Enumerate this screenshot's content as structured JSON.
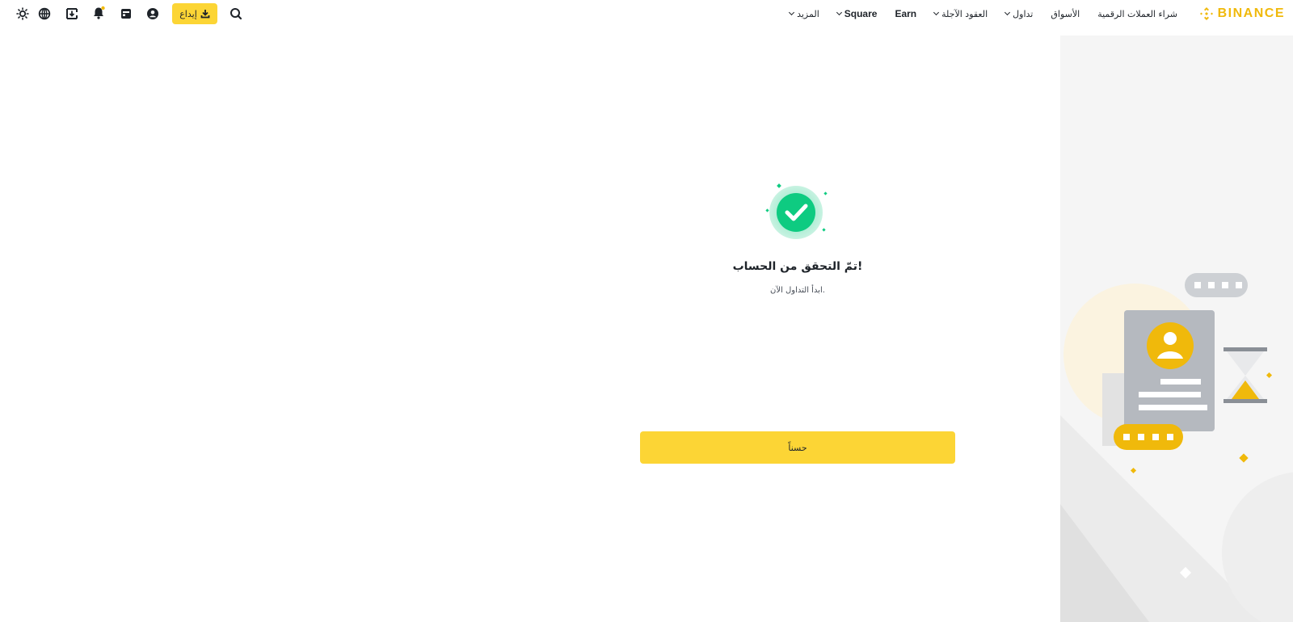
{
  "brand": {
    "name": "BINANCE",
    "color": "#F0B90B"
  },
  "nav": {
    "items": [
      {
        "label": "شراء العملات الرقمية",
        "has_dropdown": false
      },
      {
        "label": "الأسواق",
        "has_dropdown": false
      },
      {
        "label": "تداول",
        "has_dropdown": true
      },
      {
        "label": "العقود الآجلة",
        "has_dropdown": true
      },
      {
        "label": "Earn",
        "has_dropdown": false
      },
      {
        "label": "Square",
        "has_dropdown": true
      },
      {
        "label": "المزيد",
        "has_dropdown": true
      }
    ]
  },
  "toolbar": {
    "deposit_label": "إيداع",
    "icons": [
      "search-icon",
      "user-icon",
      "orders-icon",
      "notification-icon",
      "download-app-icon",
      "language-globe-icon",
      "theme-toggle-icon"
    ]
  },
  "main": {
    "title": "تمّ التحقق من الحساب!",
    "subtitle": "ابدأ التداول الآن.",
    "ok_button": "حسناً"
  },
  "colors": {
    "accent": "#FCD535",
    "success": "#0ECB81",
    "text": "#1E2329",
    "muted": "#474D57",
    "panel": "#F5F5F5"
  }
}
